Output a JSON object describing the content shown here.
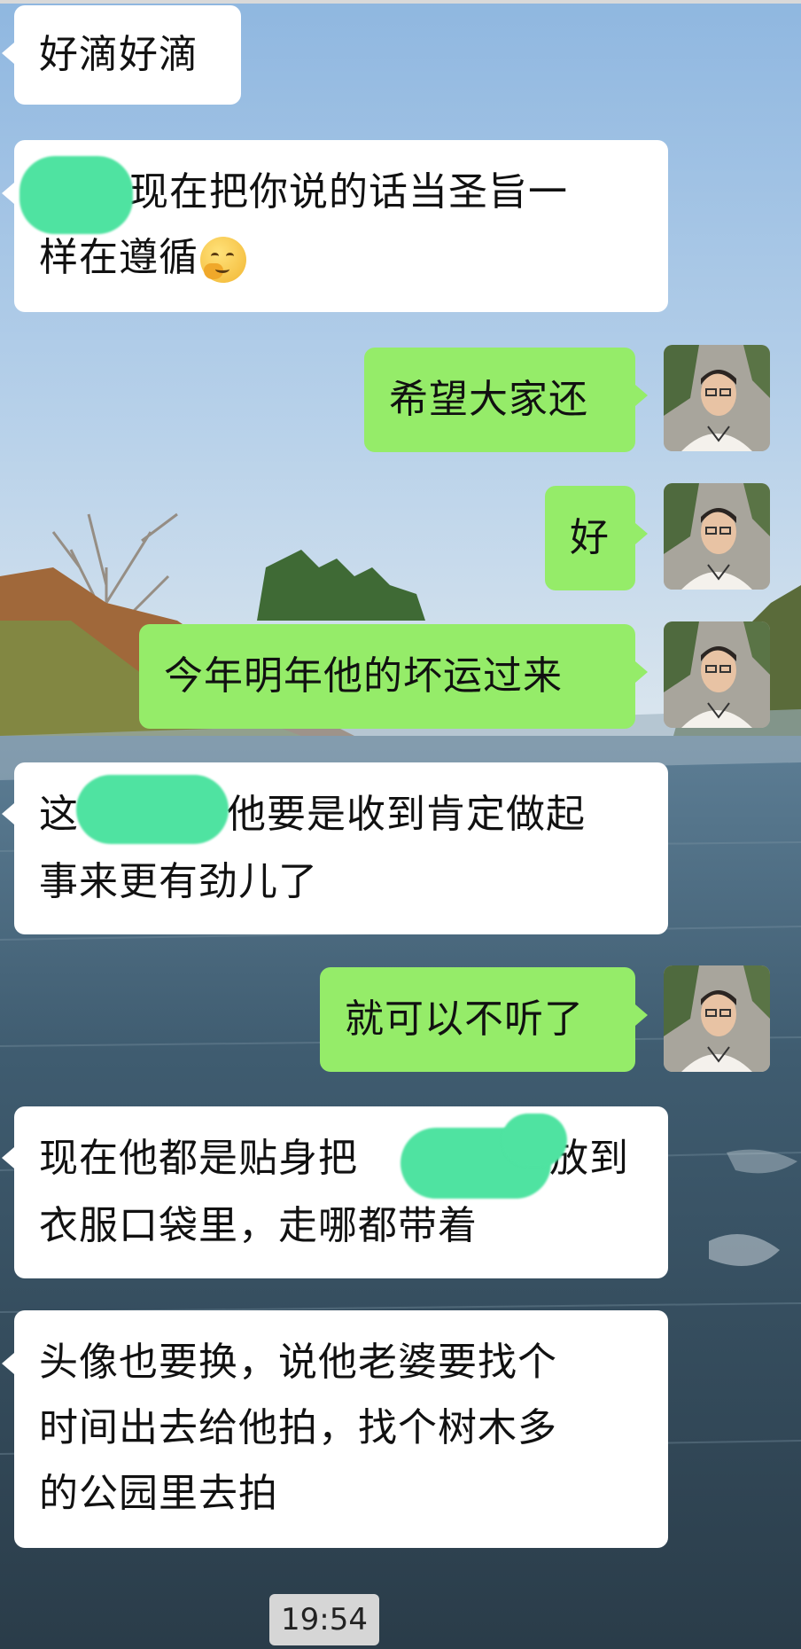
{
  "messages": [
    {
      "id": "m1",
      "side": "in",
      "lines": [
        "好滴好滴"
      ]
    },
    {
      "id": "m2",
      "side": "in",
      "lines": [
        "现在把你说的话当圣旨一",
        "样在遵循"
      ],
      "emoji": "thinking-face-emoji"
    },
    {
      "id": "m3",
      "side": "out",
      "lines": [
        "希望大家还"
      ]
    },
    {
      "id": "m4",
      "side": "out",
      "lines": [
        "好"
      ]
    },
    {
      "id": "m5",
      "side": "out",
      "lines": [
        "今年明年他的坏运过来"
      ]
    },
    {
      "id": "m6",
      "side": "in",
      "lines": [
        "这",
        "他要是收到肯定做起",
        "事来更有劲儿了"
      ]
    },
    {
      "id": "m7",
      "side": "out",
      "lines": [
        "就可以不听了"
      ]
    },
    {
      "id": "m8",
      "side": "in",
      "lines": [
        "现在他都是贴身把",
        "放到",
        "衣服口袋里，走哪都带着"
      ]
    },
    {
      "id": "m9",
      "side": "in",
      "lines": [
        "头像也要换，说他老婆要找个",
        "时间出去给他拍，找个树木多",
        "的公园里去拍"
      ]
    }
  ],
  "timestamp": "19:54",
  "colors": {
    "incoming_bubble": "#ffffff",
    "outgoing_bubble": "#95ec69",
    "redaction": "#4fe3a1",
    "timestamp_bg": "#d6d6d6"
  }
}
